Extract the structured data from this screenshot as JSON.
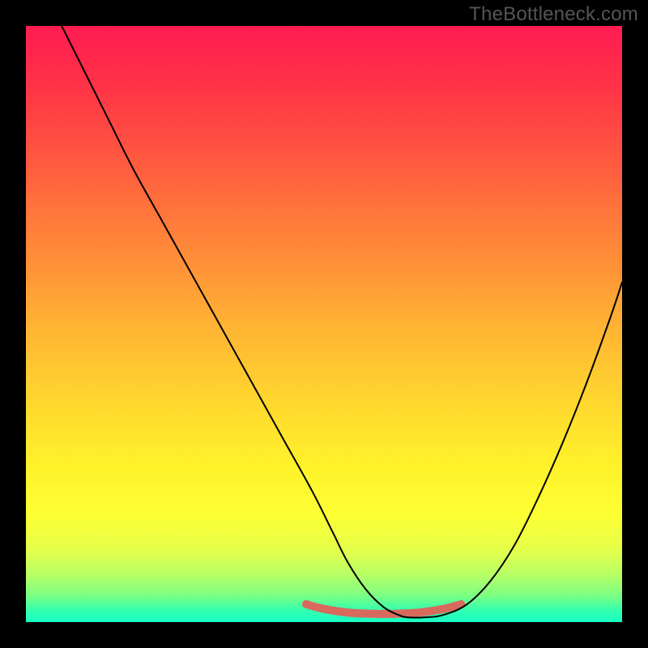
{
  "watermark": "TheBottleneck.com",
  "chart_data": {
    "type": "line",
    "title": "",
    "xlabel": "",
    "ylabel": "",
    "xlim": [
      0,
      100
    ],
    "ylim": [
      0,
      100
    ],
    "grid": false,
    "legend": "none",
    "series": [
      {
        "name": "main-curve",
        "color": "#000000",
        "x": [
          6,
          10,
          14,
          18,
          23,
          28,
          33,
          38,
          43,
          48,
          51.5,
          54,
          57,
          60,
          62.5,
          64,
          67,
          70,
          74,
          78,
          82,
          86,
          90,
          94,
          98,
          100
        ],
        "y": [
          100,
          92,
          84,
          76,
          67,
          58,
          49,
          40,
          31,
          22,
          15,
          10,
          5.5,
          2.5,
          1.2,
          0.8,
          0.8,
          1.2,
          3,
          7,
          13,
          21,
          30,
          40,
          51,
          57
        ]
      },
      {
        "name": "bottom-band",
        "color": "#d76a5d",
        "x": [
          47,
          50,
          54,
          58,
          62,
          66,
          70,
          73
        ],
        "y": [
          3.0,
          2.2,
          1.6,
          1.4,
          1.4,
          1.6,
          2.2,
          3.0
        ]
      }
    ],
    "gradient_stops": [
      {
        "pos": 0.0,
        "color": "#ff1c51"
      },
      {
        "pos": 0.09,
        "color": "#ff3048"
      },
      {
        "pos": 0.22,
        "color": "#ff5740"
      },
      {
        "pos": 0.36,
        "color": "#ff8439"
      },
      {
        "pos": 0.5,
        "color": "#ffb233"
      },
      {
        "pos": 0.63,
        "color": "#ffd72e"
      },
      {
        "pos": 0.74,
        "color": "#fff22a"
      },
      {
        "pos": 0.82,
        "color": "#fdff32"
      },
      {
        "pos": 0.88,
        "color": "#e4ff4a"
      },
      {
        "pos": 0.92,
        "color": "#b8ff65"
      },
      {
        "pos": 0.955,
        "color": "#7dff82"
      },
      {
        "pos": 0.98,
        "color": "#34ffae"
      },
      {
        "pos": 1.0,
        "color": "#18ffc6"
      }
    ]
  }
}
